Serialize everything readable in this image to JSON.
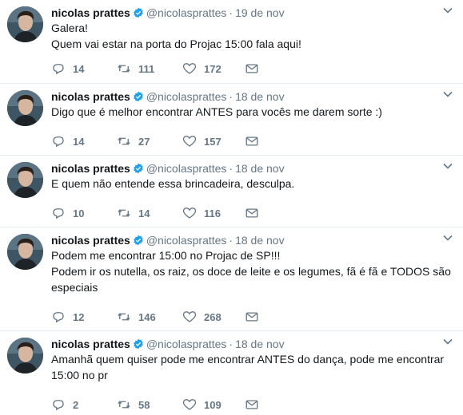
{
  "tweets": [
    {
      "name": "nicolas prattes",
      "handle": "@nicolasprattes",
      "separator": "·",
      "date": "19 de nov",
      "lines": [
        "Galera!",
        "Quem vai estar na porta do Projac 15:00 fala aqui!"
      ],
      "replies": "14",
      "retweets": "111",
      "likes": "172"
    },
    {
      "name": "nicolas prattes",
      "handle": "@nicolasprattes",
      "separator": "·",
      "date": "18 de nov",
      "lines": [
        "Digo que é melhor encontrar ANTES para vocês me darem sorte :)"
      ],
      "replies": "14",
      "retweets": "27",
      "likes": "157"
    },
    {
      "name": "nicolas prattes",
      "handle": "@nicolasprattes",
      "separator": "·",
      "date": "18 de nov",
      "lines": [
        "E quem não entende essa brincadeira, desculpa."
      ],
      "replies": "10",
      "retweets": "14",
      "likes": "116"
    },
    {
      "name": "nicolas prattes",
      "handle": "@nicolasprattes",
      "separator": "·",
      "date": "18 de nov",
      "lines": [
        "Podem me encontrar 15:00 no Projac de SP!!!",
        "Podem ir os nutella, os raiz, os doce de leite e os legumes, fã é fã e TODOS são",
        "especiais"
      ],
      "replies": "12",
      "retweets": "146",
      "likes": "268"
    },
    {
      "name": "nicolas prattes",
      "handle": "@nicolasprattes",
      "separator": "·",
      "date": "18 de nov",
      "lines": [
        "Amanhã quem quiser pode me encontrar ANTES do dança, pode me encontrar",
        "15:00 no pr"
      ],
      "replies": "2",
      "retweets": "58",
      "likes": "109"
    }
  ],
  "icons": {
    "verified": "verified-badge-icon",
    "caret": "chevron-down-icon",
    "reply": "reply-icon",
    "retweet": "retweet-icon",
    "like": "heart-icon",
    "dm": "envelope-icon"
  },
  "colors": {
    "verified_blue": "#1da1f2",
    "muted_text": "#657786",
    "divider": "#e6ecf0"
  }
}
